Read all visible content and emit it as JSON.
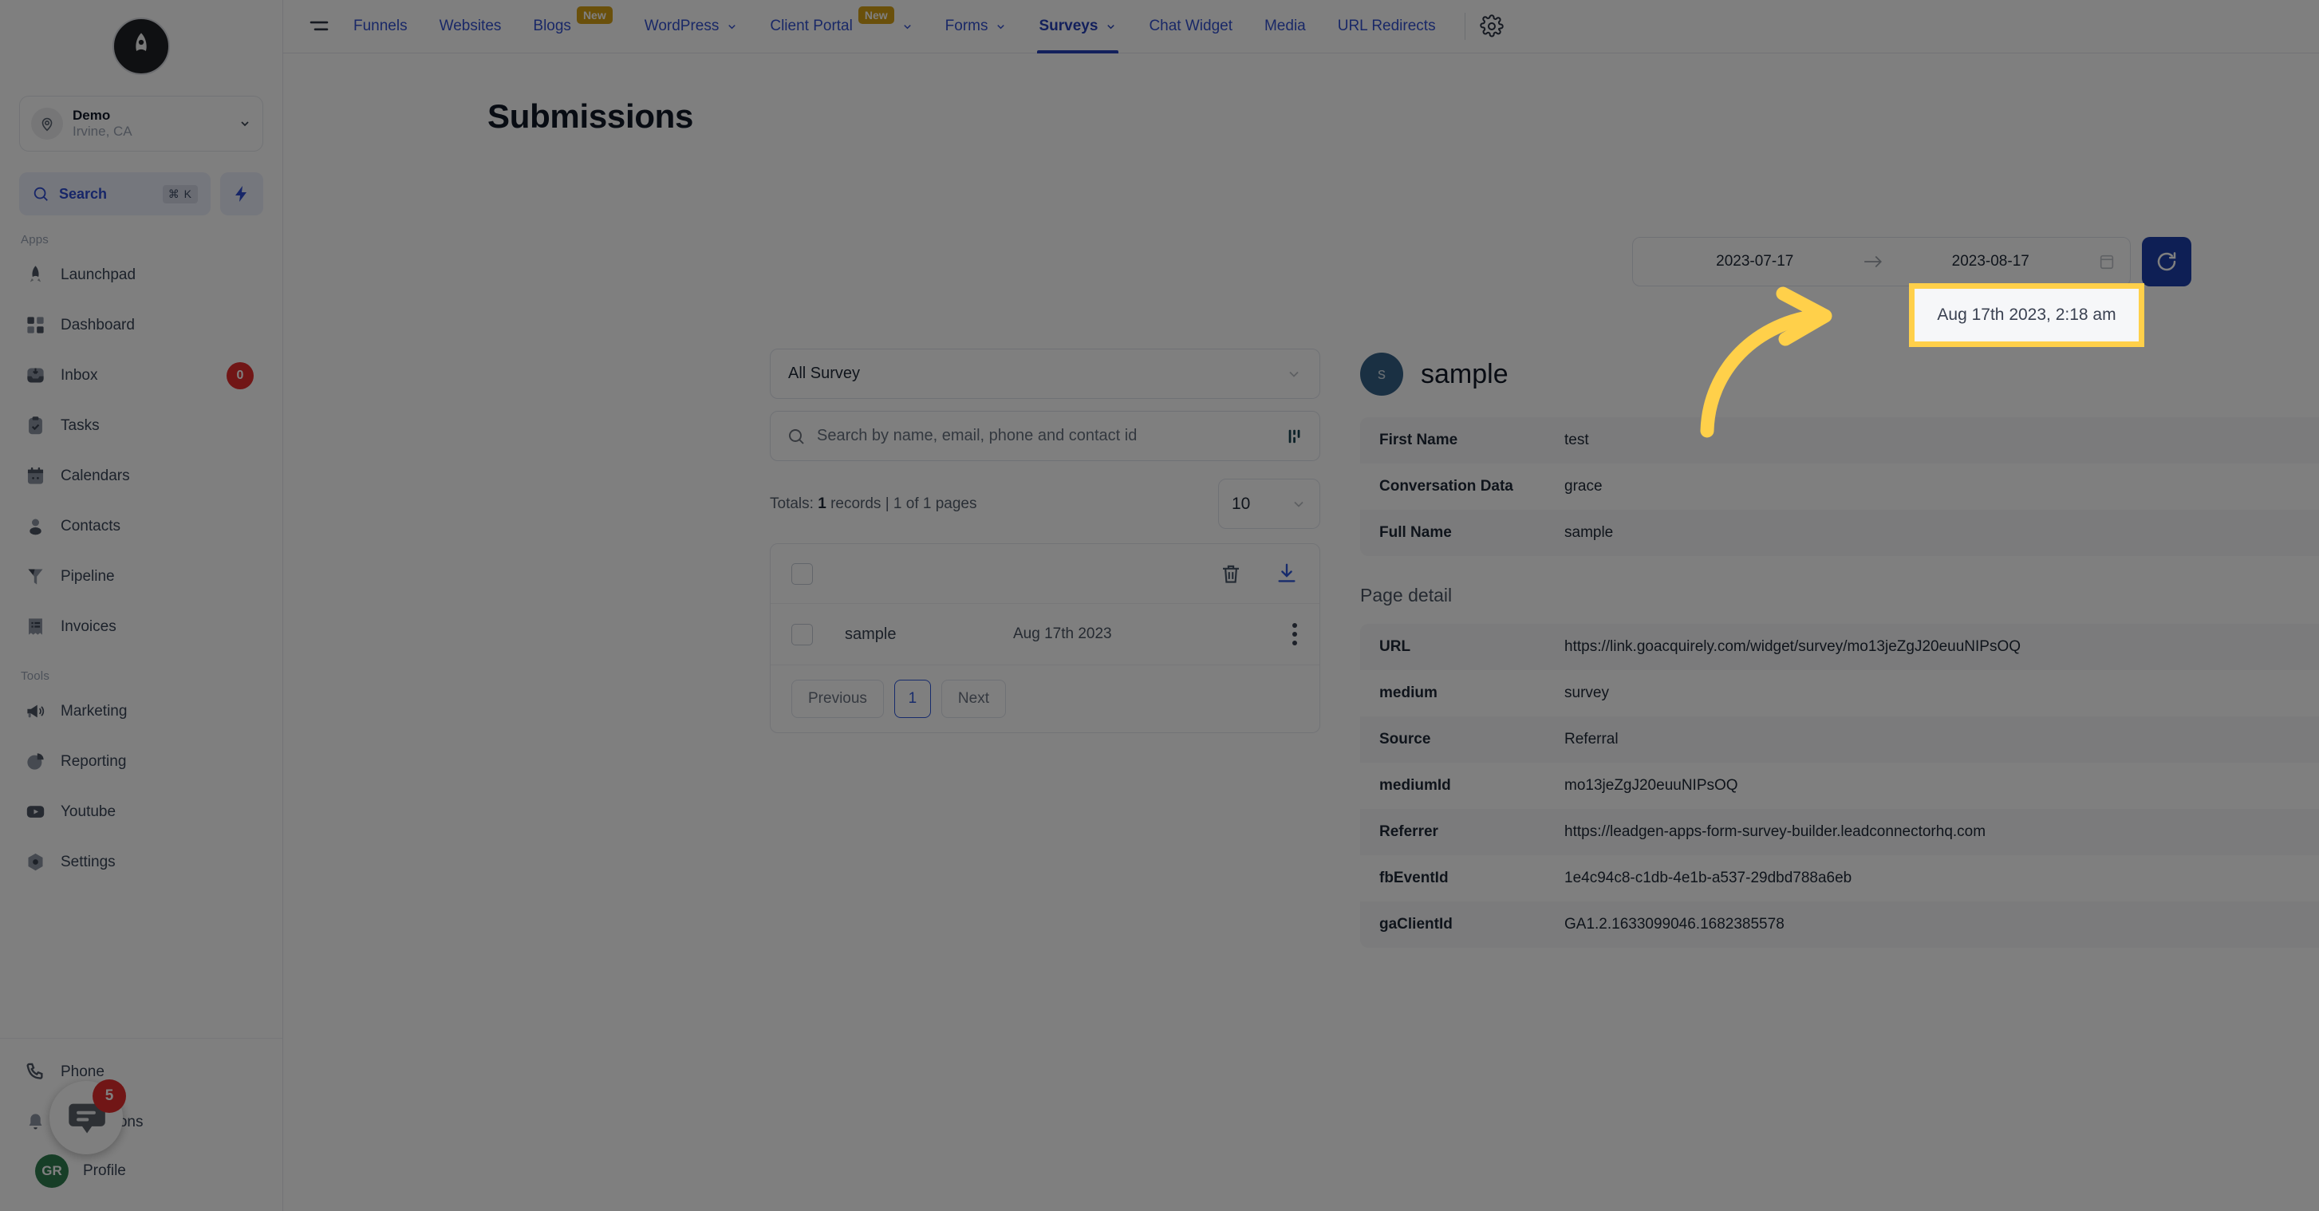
{
  "brand": {
    "logo_icon": "rocket-logo-icon"
  },
  "sidebar": {
    "location": {
      "name": "Demo",
      "sub": "Irvine, CA",
      "pin_icon": "map-pin-icon",
      "chevron_icon": "chevron-down-icon"
    },
    "search": {
      "label": "Search",
      "shortcut": "⌘ K",
      "icon": "search-icon"
    },
    "quick_action_icon": "lightning-bolt-icon",
    "groups": [
      {
        "label": "Apps",
        "items": [
          {
            "label": "Launchpad",
            "icon": "rocket-icon",
            "badge": ""
          },
          {
            "label": "Dashboard",
            "icon": "grid-icon",
            "badge": ""
          },
          {
            "label": "Inbox",
            "icon": "inbox-icon",
            "badge": "0"
          },
          {
            "label": "Tasks",
            "icon": "clipboard-check-icon",
            "badge": ""
          },
          {
            "label": "Calendars",
            "icon": "calendar-icon",
            "badge": ""
          },
          {
            "label": "Contacts",
            "icon": "user-icon",
            "badge": ""
          },
          {
            "label": "Pipeline",
            "icon": "funnel-icon",
            "badge": ""
          },
          {
            "label": "Invoices",
            "icon": "invoice-icon",
            "badge": ""
          }
        ]
      },
      {
        "label": "Tools",
        "items": [
          {
            "label": "Marketing",
            "icon": "megaphone-icon",
            "badge": ""
          },
          {
            "label": "Reporting",
            "icon": "pie-chart-icon",
            "badge": ""
          },
          {
            "label": "Youtube",
            "icon": "youtube-icon",
            "badge": ""
          },
          {
            "label": "Settings",
            "icon": "gear-icon",
            "badge": ""
          }
        ]
      }
    ],
    "bottom": [
      {
        "label": "Phone",
        "icon": "phone-icon"
      },
      {
        "label": "Notifications",
        "icon": "bell-icon"
      }
    ],
    "profile": {
      "label": "Profile",
      "initials": "GR"
    }
  },
  "topnav": {
    "menu_icon": "hamburger-menu-icon",
    "items": [
      {
        "label": "Funnels",
        "badge": "",
        "chevron": false,
        "active": false
      },
      {
        "label": "Websites",
        "badge": "",
        "chevron": false,
        "active": false
      },
      {
        "label": "Blogs",
        "badge": "New",
        "chevron": false,
        "active": false
      },
      {
        "label": "WordPress",
        "badge": "",
        "chevron": true,
        "active": false
      },
      {
        "label": "Client Portal",
        "badge": "New",
        "chevron": true,
        "active": false
      },
      {
        "label": "Forms",
        "badge": "",
        "chevron": true,
        "active": false
      },
      {
        "label": "Surveys",
        "badge": "",
        "chevron": true,
        "active": true
      },
      {
        "label": "Chat Widget",
        "badge": "",
        "chevron": false,
        "active": false
      },
      {
        "label": "Media",
        "badge": "",
        "chevron": false,
        "active": false
      },
      {
        "label": "URL Redirects",
        "badge": "",
        "chevron": false,
        "active": false
      }
    ],
    "settings_icon": "gear-icon"
  },
  "page": {
    "title": "Submissions"
  },
  "daterange": {
    "start": "2023-07-17",
    "end": "2023-08-17",
    "arrow_icon": "arrow-right-icon",
    "calendar_icon": "calendar-icon",
    "refresh_icon": "refresh-icon"
  },
  "filters": {
    "survey_select": {
      "value": "All Survey",
      "chevron_icon": "chevron-down-icon"
    },
    "search": {
      "placeholder": "Search by name, email, phone and contact id",
      "icon": "search-icon",
      "filter_icon": "filter-bars-icon"
    },
    "totals_prefix": "Totals:",
    "totals_count": "1",
    "totals_suffix": "records | 1 of 1 pages",
    "per_page": {
      "value": "10",
      "chevron_icon": "chevron-down-icon"
    }
  },
  "list": {
    "select_all_checkbox": "unchecked",
    "delete_icon": "trash-icon",
    "download_icon": "download-icon",
    "rows": [
      {
        "name": "sample",
        "date": "Aug 17th 2023",
        "checkbox": "unchecked",
        "menu_icon": "kebab-menu-icon"
      }
    ],
    "pagination": {
      "previous": "Previous",
      "current": "1",
      "next": "Next"
    }
  },
  "detail": {
    "avatar_initial": "s",
    "title": "sample",
    "fields": [
      {
        "key": "First Name",
        "value": "test"
      },
      {
        "key": "Conversation Data",
        "value": "grace"
      },
      {
        "key": "Full Name",
        "value": "sample"
      }
    ],
    "page_detail_title": "Page detail",
    "page_detail": [
      {
        "key": "URL",
        "value": "https://link.goacquirely.com/widget/survey/mo13jeZgJ20euuNIPsOQ"
      },
      {
        "key": "medium",
        "value": "survey"
      },
      {
        "key": "Source",
        "value": "Referral"
      },
      {
        "key": "mediumId",
        "value": "mo13jeZgJ20euuNIPsOQ"
      },
      {
        "key": "Referrer",
        "value": "https://leadgen-apps-form-survey-builder.leadconnectorhq.com"
      },
      {
        "key": "fbEventId",
        "value": "1e4c94c8-c1db-4e1b-a537-29dbd788a6eb"
      },
      {
        "key": "gaClientId",
        "value": "GA1.2.1633099046.1682385578"
      }
    ]
  },
  "annotation": {
    "highlight_text": "Aug 17th 2023, 2:18 am",
    "highlight_color": "#FFD04A",
    "arrow_icon": "curved-arrow-icon"
  },
  "chat_widget": {
    "badge": "5",
    "icon": "chat-bubble-icon"
  }
}
